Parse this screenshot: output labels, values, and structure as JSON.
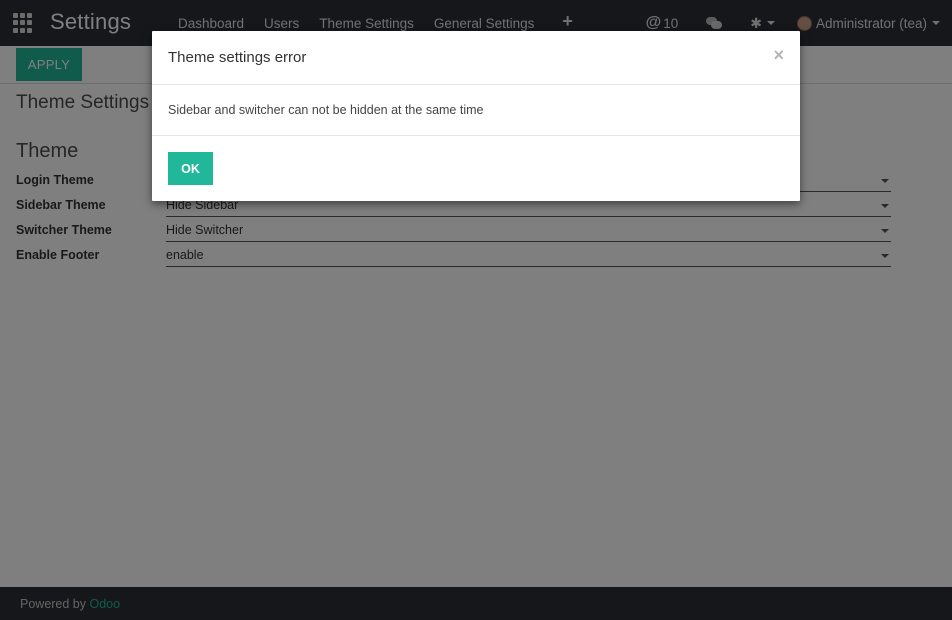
{
  "navbar": {
    "brand": "Settings",
    "menu": [
      "Dashboard",
      "Users",
      "Theme Settings",
      "General Settings"
    ],
    "add_icon": "plus-icon",
    "mentions_count": "10",
    "user_label": "Administrator (tea)"
  },
  "control_panel": {
    "apply_label": "APPLY"
  },
  "page": {
    "title": "Theme Settings",
    "section": "Theme",
    "fields": [
      {
        "label": "Login Theme",
        "value": ""
      },
      {
        "label": "Sidebar Theme",
        "value": "Hide Sidebar"
      },
      {
        "label": "Switcher Theme",
        "value": "Hide Switcher"
      },
      {
        "label": "Enable Footer",
        "value": "enable"
      }
    ]
  },
  "footer": {
    "powered_by": "Powered by",
    "brand": "Odoo"
  },
  "modal": {
    "title": "Theme settings error",
    "close_glyph": "×",
    "message": "Sidebar and switcher can not be hidden at the same time",
    "ok_label": "OK"
  },
  "colors": {
    "navbar_bg": "#2a2f35",
    "accent": "#21b799"
  }
}
